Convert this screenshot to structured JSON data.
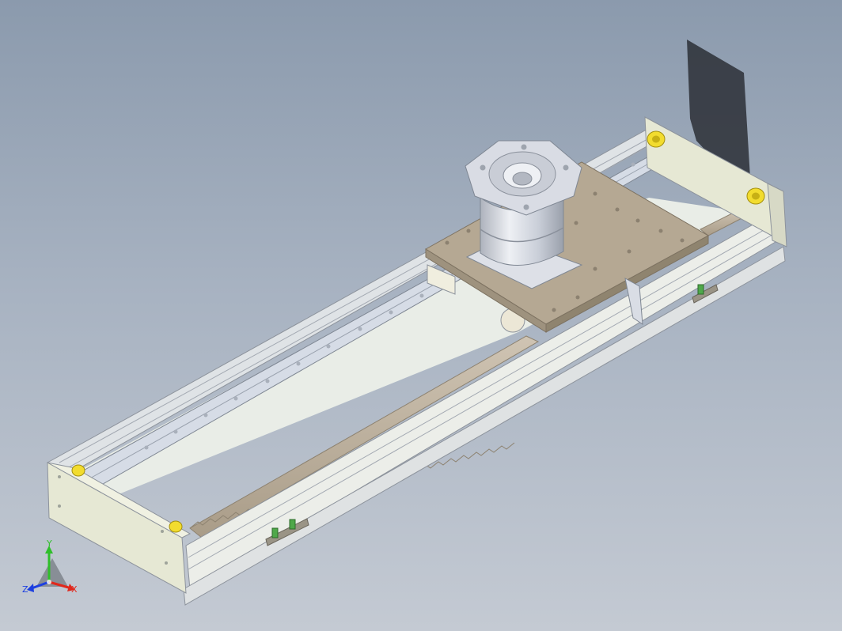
{
  "viewport": {
    "background_top": "#8b9aad",
    "background_bottom": "#c4cad3"
  },
  "model": {
    "parts": [
      "linear-module-frame",
      "end-plate-left",
      "end-plate-right",
      "guide-rail",
      "gear-rack",
      "carriage-plate",
      "planetary-gearbox",
      "motor-flange",
      "limit-sensor",
      "bumper"
    ],
    "colors": {
      "frame": "#e8ebe6",
      "end_plate": "#e6e8d4",
      "rail": "#d6dce6",
      "rack": "#bfb3a2",
      "carriage": "#b5a893",
      "gearbox": "#d8dce4",
      "bumper": "#f2dc2e",
      "sensor": "#4fa84a",
      "shadow": "#2b2f36"
    }
  },
  "triad": {
    "x_label": "X",
    "y_label": "Y",
    "z_label": "Z",
    "x_color": "#e0281c",
    "y_color": "#2fbf2a",
    "z_color": "#1c3fe0"
  }
}
